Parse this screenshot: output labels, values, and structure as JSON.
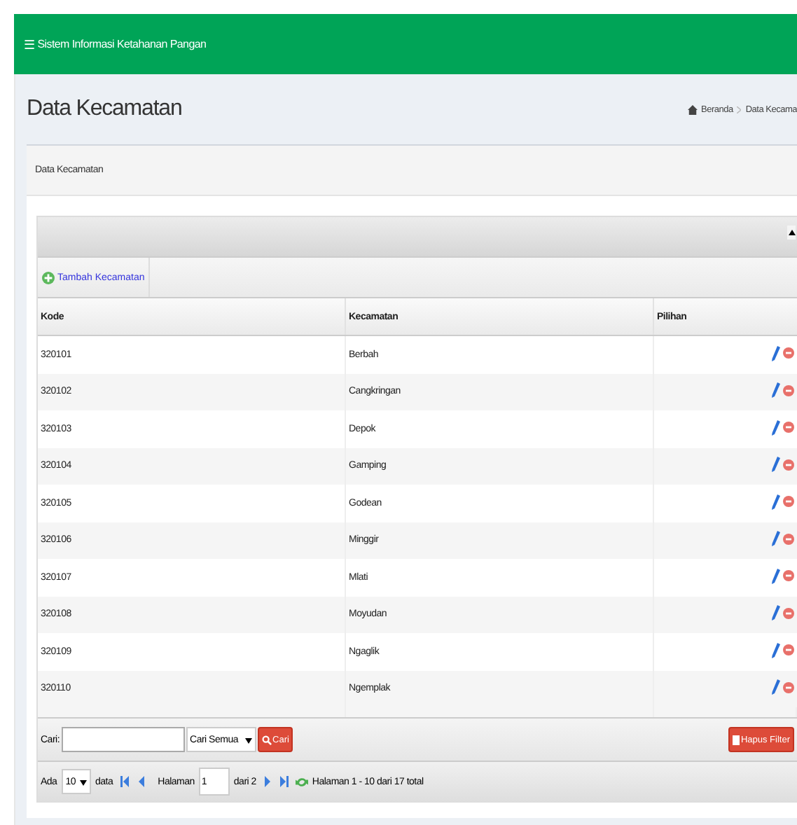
{
  "navbar": {
    "menu_icon": "☰",
    "title": "Sistem Informasi Ketahanan Pangan"
  },
  "page": {
    "title": "Data Kecamatan",
    "breadcrumb": [
      "Beranda",
      "Data Kecama"
    ]
  },
  "box": {
    "title": "Data Kecamatan"
  },
  "grid": {
    "add_button": "Tambah Kecamatan",
    "columns": [
      "Kode",
      "Kecamatan",
      "Pilihan"
    ],
    "rows": [
      {
        "kode": "320101",
        "kecamatan": "Berbah"
      },
      {
        "kode": "320102",
        "kecamatan": "Cangkringan"
      },
      {
        "kode": "320103",
        "kecamatan": "Depok"
      },
      {
        "kode": "320104",
        "kecamatan": "Gamping"
      },
      {
        "kode": "320105",
        "kecamatan": "Godean"
      },
      {
        "kode": "320106",
        "kecamatan": "Minggir"
      },
      {
        "kode": "320107",
        "kecamatan": "Mlati"
      },
      {
        "kode": "320108",
        "kecamatan": "Moyudan"
      },
      {
        "kode": "320109",
        "kecamatan": "Ngaglik"
      },
      {
        "kode": "320110",
        "kecamatan": "Ngemplak"
      }
    ],
    "search": {
      "label": "Cari:",
      "scope": "Cari Semua",
      "button": "Cari",
      "clear_button": "Hapus Filter"
    },
    "pager": {
      "show_label": "Ada",
      "page_size": "10",
      "data_label": "data",
      "page_label": "Halaman",
      "page": "1",
      "of_label": "dari 2",
      "summary": "Halaman 1 - 10 dari 17 total"
    }
  }
}
